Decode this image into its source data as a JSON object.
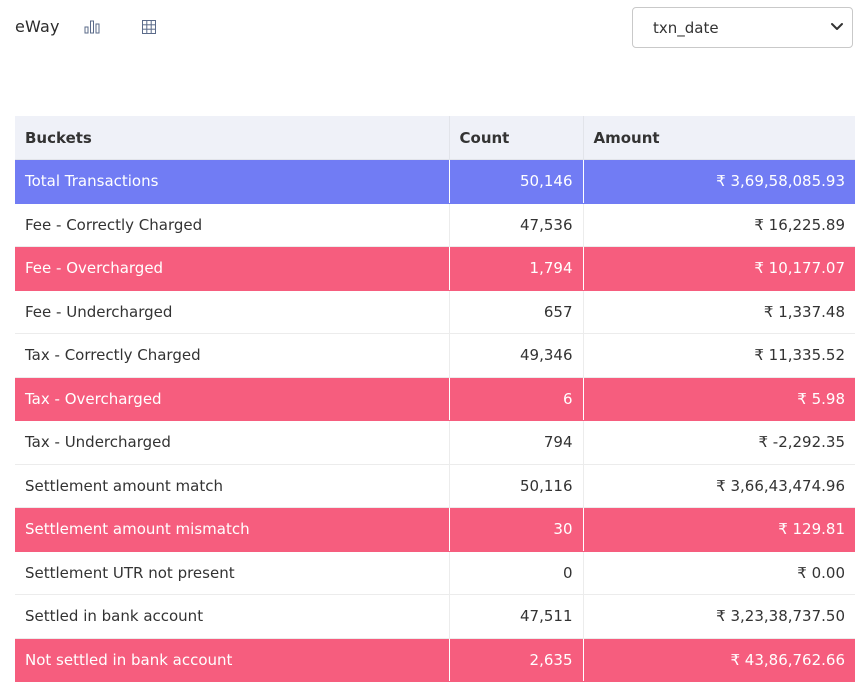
{
  "header": {
    "brand": "eWay",
    "chart_icon": "bar-chart-icon",
    "table_icon": "table-grid-icon",
    "date_field_select": {
      "value": "txn_date"
    }
  },
  "colors": {
    "total_row": "#717cf4",
    "alert_row": "#f65d7e",
    "header_bg": "#eff1f8"
  },
  "table": {
    "columns": [
      "Buckets",
      "Count",
      "Amount"
    ],
    "rows": [
      {
        "bucket": "Total Transactions",
        "count": "50,146",
        "amount": "₹ 3,69,58,085.93",
        "style": "total"
      },
      {
        "bucket": "Fee - Correctly Charged",
        "count": "47,536",
        "amount": "₹ 16,225.89",
        "style": "normal"
      },
      {
        "bucket": "Fee - Overcharged",
        "count": "1,794",
        "amount": "₹ 10,177.07",
        "style": "alert"
      },
      {
        "bucket": "Fee - Undercharged",
        "count": "657",
        "amount": "₹ 1,337.48",
        "style": "normal"
      },
      {
        "bucket": "Tax - Correctly Charged",
        "count": "49,346",
        "amount": "₹ 11,335.52",
        "style": "normal"
      },
      {
        "bucket": "Tax - Overcharged",
        "count": "6",
        "amount": "₹ 5.98",
        "style": "alert"
      },
      {
        "bucket": "Tax - Undercharged",
        "count": "794",
        "amount": "₹ -2,292.35",
        "style": "normal"
      },
      {
        "bucket": "Settlement amount match",
        "count": "50,116",
        "amount": "₹ 3,66,43,474.96",
        "style": "normal"
      },
      {
        "bucket": "Settlement amount mismatch",
        "count": "30",
        "amount": "₹ 129.81",
        "style": "alert"
      },
      {
        "bucket": "Settlement UTR not present",
        "count": "0",
        "amount": "₹ 0.00",
        "style": "normal"
      },
      {
        "bucket": "Settled in bank account",
        "count": "47,511",
        "amount": "₹ 3,23,38,737.50",
        "style": "normal"
      },
      {
        "bucket": "Not settled in bank account",
        "count": "2,635",
        "amount": "₹ 43,86,762.66",
        "style": "alert"
      }
    ]
  }
}
